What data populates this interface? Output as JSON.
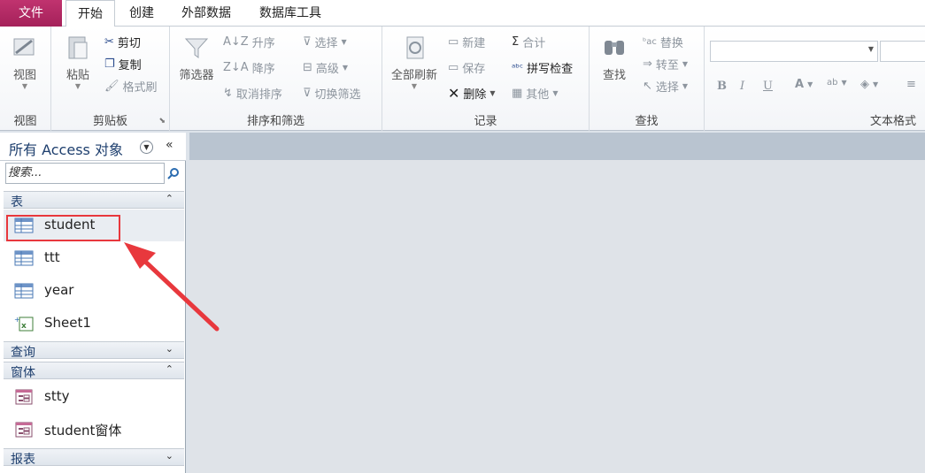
{
  "tabs": {
    "file": "文件",
    "items": [
      "开始",
      "创建",
      "外部数据",
      "数据库工具"
    ]
  },
  "ribbon": {
    "view_group": {
      "button": "视图",
      "label": "视图"
    },
    "clipboard_group": {
      "paste": "粘贴",
      "cut": "剪切",
      "copy": "复制",
      "format_painter": "格式刷",
      "label": "剪贴板"
    },
    "sort_filter_group": {
      "filter": "筛选器",
      "ascending": "升序",
      "descending": "降序",
      "remove_sort": "取消排序",
      "selection": "选择",
      "advanced": "高级",
      "toggle_filter": "切换筛选",
      "label": "排序和筛选"
    },
    "records_group": {
      "refresh_all": "全部刷新",
      "new": "新建",
      "save": "保存",
      "delete": "删除",
      "totals": "合计",
      "spelling": "拼写检查",
      "more": "其他",
      "label": "记录"
    },
    "find_group": {
      "find": "查找",
      "replace": "替换",
      "goto": "转至",
      "select": "选择",
      "label": "查找"
    },
    "text_format_group": {
      "bold": "B",
      "italic": "I",
      "underline": "U",
      "label": "文本格式"
    }
  },
  "nav": {
    "title": "所有 Access 对象",
    "search_placeholder": "搜索...",
    "sections": {
      "tables": "表",
      "queries": "查询",
      "forms": "窗体",
      "reports": "报表"
    },
    "tables": [
      "student",
      "ttt",
      "year",
      "Sheet1"
    ],
    "forms": [
      "stty",
      "student窗体"
    ]
  },
  "colors": {
    "file_tab": "#b02a63",
    "highlight": "#e8383d",
    "arrow": "#e8383d"
  }
}
